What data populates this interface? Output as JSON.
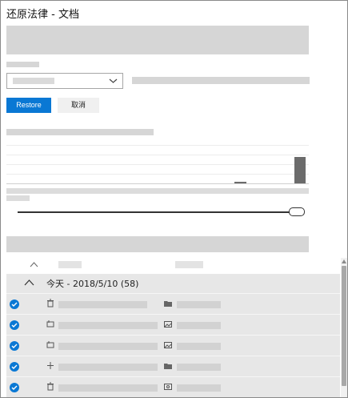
{
  "window": {
    "title": "还原法律 - 文档"
  },
  "actions": {
    "restore_label": "Restore",
    "cancel_label": "取消"
  },
  "list": {
    "group_label": "今天 - 2018/5/10 (58)",
    "rows": [
      {
        "checked": true,
        "file_icon": "trash-icon",
        "type_icon": "folder-icon"
      },
      {
        "checked": true,
        "file_icon": "image-edit-icon",
        "type_icon": "image-icon"
      },
      {
        "checked": true,
        "file_icon": "image-edit-icon",
        "type_icon": "image-icon"
      },
      {
        "checked": true,
        "file_icon": "add-icon",
        "type_icon": "folder-icon"
      },
      {
        "checked": true,
        "file_icon": "trash-icon",
        "type_icon": "file-icon"
      }
    ]
  },
  "colors": {
    "accent": "#0a78d4",
    "placeholder": "#d6d6d6",
    "group_background": "#e7e7e7"
  }
}
